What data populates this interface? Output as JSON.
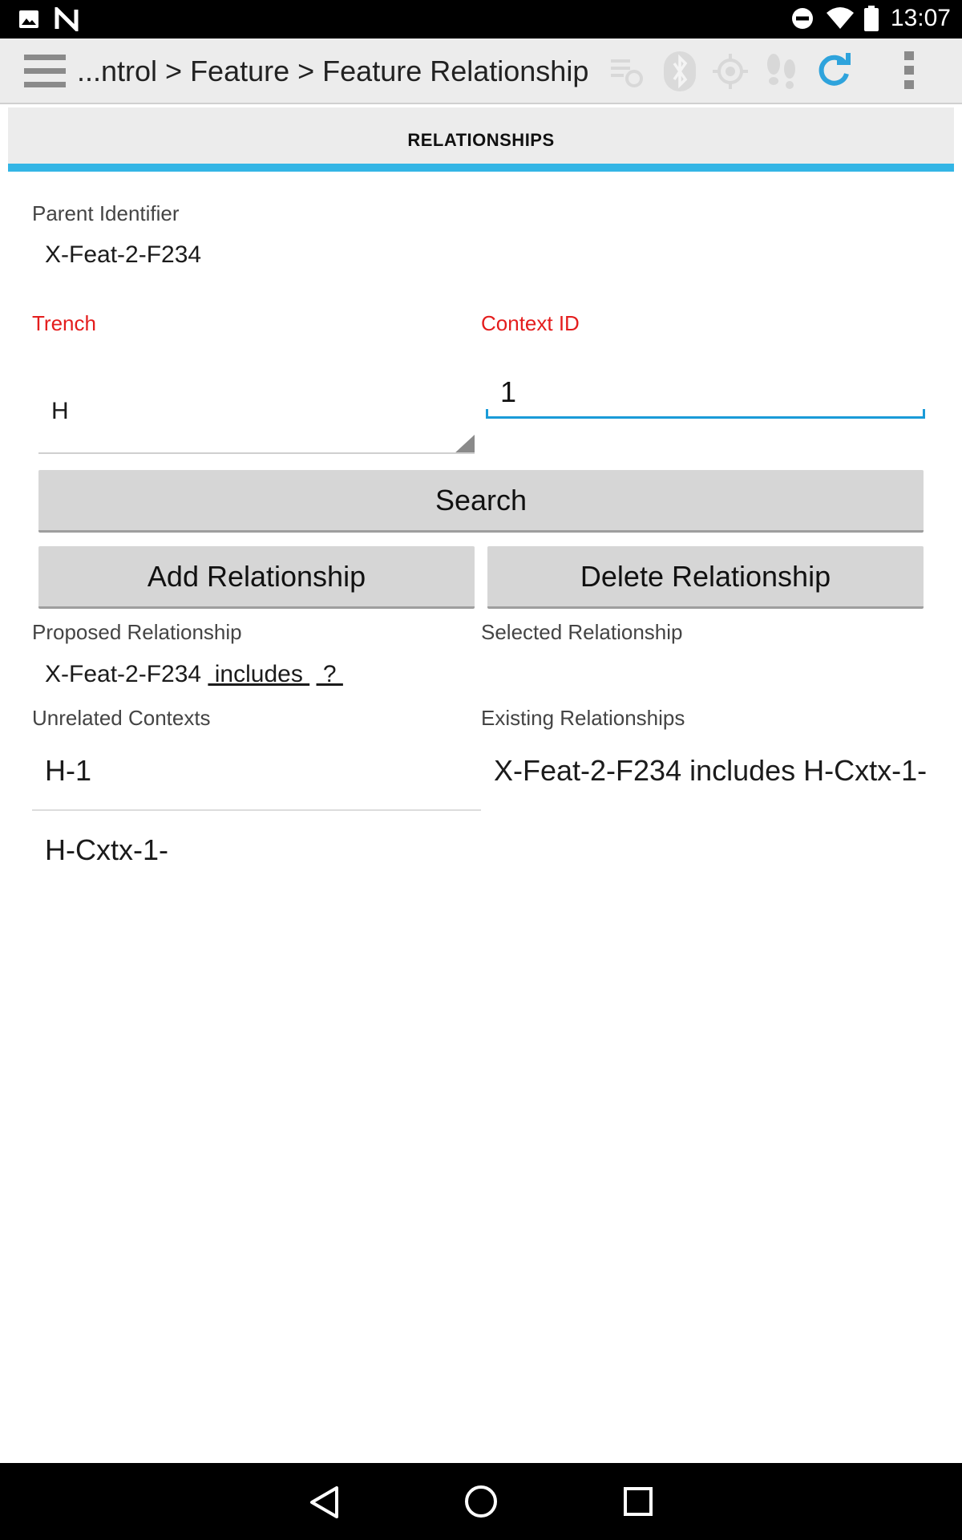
{
  "status_bar": {
    "time": "13:07",
    "icons": [
      "image-icon",
      "n-logo-icon",
      "do-not-disturb-icon",
      "wifi-icon",
      "battery-icon"
    ]
  },
  "action_bar": {
    "title": "...ntrol > Feature > Feature Relationship",
    "icons": [
      "menu-icon",
      "sync-list-icon",
      "bluetooth-icon",
      "gps-icon",
      "footsteps-icon",
      "refresh-icon",
      "overflow-menu-icon"
    ],
    "accent_color": "#33b5e5"
  },
  "tab": {
    "label": "RELATIONSHIPS"
  },
  "form": {
    "parent_identifier_label": "Parent Identifier",
    "parent_identifier_value": "X-Feat-2-F234",
    "trench_label": "Trench",
    "trench_value": "H",
    "context_id_label": "Context ID",
    "context_id_value": "1",
    "required_color": "#e41d1d"
  },
  "buttons": {
    "search": "Search",
    "add_relationship": "Add Relationship",
    "delete_relationship": "Delete Relationship"
  },
  "proposed": {
    "label": "Proposed Relationship",
    "parent": "X-Feat-2-F234",
    "relation": " includes ",
    "child": " ? "
  },
  "selected": {
    "label": "Selected Relationship",
    "value": ""
  },
  "unrelated": {
    "label": "Unrelated Contexts",
    "items": [
      "H-1",
      "H-Cxtx-1-"
    ]
  },
  "existing": {
    "label": "Existing Relationships",
    "items": [
      "X-Feat-2-F234 includes H-Cxtx-1-"
    ]
  },
  "nav_bar": {
    "icons": [
      "back-icon",
      "home-icon",
      "recents-icon"
    ]
  }
}
